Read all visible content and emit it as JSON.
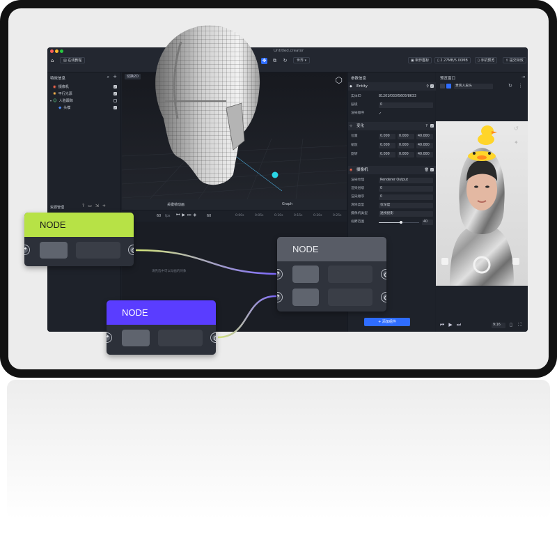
{
  "app": {
    "window_title": "Untitled.creator",
    "tutorial_label": "在线教程",
    "world_select": "世界 ▾",
    "memory_label": "2.27MB/5.00MB",
    "make_icon_label": "制作图标",
    "phone_preview_label": "手机预览",
    "submit_label": "提交特效"
  },
  "left_panel": {
    "title": "特效信息",
    "items": [
      {
        "label": "摄像机",
        "icon": "camera-icon",
        "checked": true
      },
      {
        "label": "平行光源",
        "icon": "light-icon",
        "checked": true
      },
      {
        "label": "人脸跟踪",
        "icon": "face-track-icon",
        "checked": false
      },
      {
        "label": "头模",
        "icon": "head-model-icon",
        "checked": true
      }
    ],
    "assets_title": "资源管理"
  },
  "viewport": {
    "tab_label": "切换2D",
    "bottom_tabs": [
      "关键帧动画",
      "Graph"
    ],
    "playbar": {
      "fps": "60",
      "fps_unit": "fps",
      "frame": "60"
    },
    "ticks": [
      "0:00s",
      "0:05s",
      "0:10s",
      "0:15s",
      "0:20s",
      "0:25s"
    ],
    "hint": "请先选中可以动画的对象"
  },
  "right_panel": {
    "title": "参数信息",
    "entity": {
      "header": "Entity",
      "id_label": "实体ID",
      "id_value": "81201f033f5605f8633",
      "layer_label": "层级",
      "layer_value": "0",
      "render_label": "渲染顺序"
    },
    "transform": {
      "header": "变化",
      "rows": [
        {
          "label": "位置",
          "values": [
            "0.000",
            "0.000",
            "40.000"
          ]
        },
        {
          "label": "缩放",
          "values": [
            "0.000",
            "0.000",
            "40.000"
          ]
        },
        {
          "label": "旋转",
          "values": [
            "0.000",
            "0.000",
            "40.000"
          ]
        }
      ]
    },
    "camera": {
      "header": "摄像机",
      "rows": [
        {
          "label": "渲染纹理",
          "value": "Renderer Output"
        },
        {
          "label": "渲染层级",
          "value": "0"
        },
        {
          "label": "渲染顺序",
          "value": "0"
        },
        {
          "label": "清除类型",
          "value": "仅深度"
        },
        {
          "label": "摄像机类型",
          "value": "透视投影"
        }
      ],
      "fov_label": "视野范围",
      "fov_value": "40",
      "fov_fraction": 0.55
    },
    "add_component": "+ 添加组件"
  },
  "preview": {
    "title": "预览窗口",
    "filter_select": "贵宾人皮头",
    "ratio": "9:16"
  },
  "nodes": [
    {
      "label": "NODE",
      "color": "#b7e246",
      "text_color": "#1a1a1a"
    },
    {
      "label": "NODE",
      "color": "#5a3dff",
      "text_color": "#ffffff"
    },
    {
      "label": "NODE",
      "color": "#585c66",
      "text_color": "#e9ebef"
    }
  ],
  "colors": {
    "accent": "#2f6dff",
    "app_bg": "#1c2028",
    "wire_start": "#d6e87a",
    "wire_end": "#7d68ff"
  }
}
